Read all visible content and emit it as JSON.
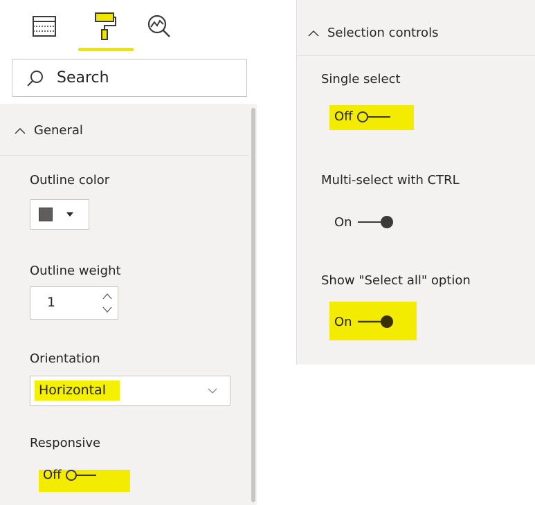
{
  "left": {
    "tabs": [
      {
        "name": "fields-tab",
        "icon": "fields-grid-icon"
      },
      {
        "name": "format-tab",
        "icon": "paint-roller-icon",
        "active": true
      },
      {
        "name": "analytics-tab",
        "icon": "analytics-magnifier-icon"
      }
    ],
    "search": {
      "placeholder": "Search"
    },
    "general": {
      "header": "General",
      "outline_color_label": "Outline color",
      "outline_color_value": "#605e5c",
      "outline_weight_label": "Outline weight",
      "outline_weight_value": "1",
      "orientation_label": "Orientation",
      "orientation_value": "Horizontal",
      "responsive_label": "Responsive",
      "responsive_state": "Off"
    }
  },
  "right": {
    "selection": {
      "header": "Selection controls",
      "single_select_label": "Single select",
      "single_select_state": "Off",
      "multi_select_label": "Multi-select with CTRL",
      "multi_select_state": "On",
      "select_all_label": "Show \"Select all\" option",
      "select_all_state": "On"
    }
  },
  "colors": {
    "highlight": "#f3ec00",
    "panel_bg": "#f3f2f1",
    "toggle_dark": "#3b3a39"
  }
}
